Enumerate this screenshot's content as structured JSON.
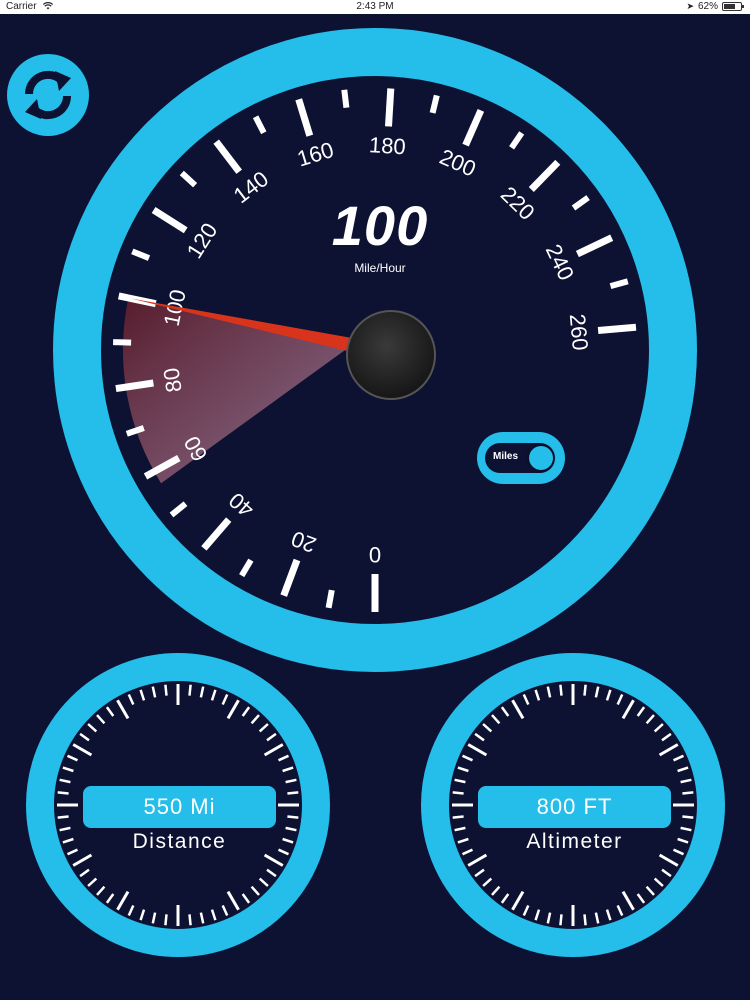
{
  "status_bar": {
    "carrier": "Carrier",
    "time": "2:43 PM",
    "battery": "62%"
  },
  "colors": {
    "background": "#0d1233",
    "accent": "#25bde9",
    "needle": "#d8341b",
    "ticks": "#ffffff"
  },
  "speedometer": {
    "value": "100",
    "unit": "Mile/Hour",
    "needle_value": 100,
    "scale_min": 0,
    "scale_max": 260,
    "scale_labels": [
      "0",
      "20",
      "40",
      "60",
      "80",
      "100",
      "120",
      "140",
      "160",
      "180",
      "200",
      "220",
      "240",
      "260"
    ]
  },
  "unit_toggle": {
    "label": "Miles",
    "state": "on"
  },
  "distance_gauge": {
    "value": "550 Mi",
    "label": "Distance"
  },
  "altimeter_gauge": {
    "value": "800 FT",
    "label": "Altimeter"
  },
  "icons": {
    "refresh": "refresh-icon",
    "wifi": "wifi-icon",
    "location": "location-arrow-icon",
    "battery": "battery-icon"
  }
}
